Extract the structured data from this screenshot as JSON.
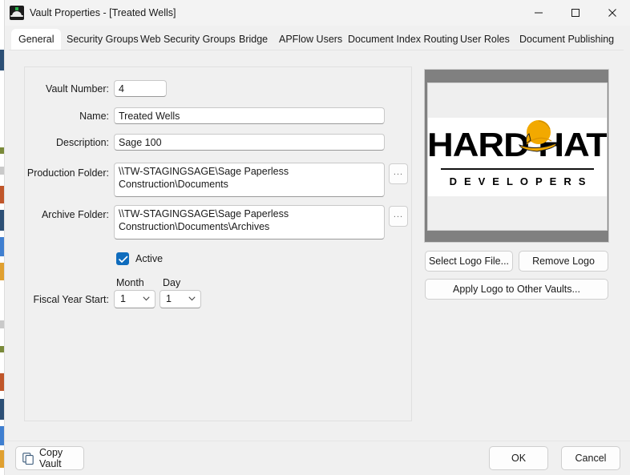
{
  "window": {
    "title": "Vault Properties - [Treated Wells]",
    "app_icon": "hard-hat-icon",
    "controls": {
      "minimize": "minimize-icon",
      "maximize": "maximize-icon",
      "close": "close-icon"
    }
  },
  "tabs": [
    {
      "label": "General",
      "active": true
    },
    {
      "label": "Security Groups",
      "active": false
    },
    {
      "label": "Web Security Groups",
      "active": false
    },
    {
      "label": "Bridge",
      "active": false
    },
    {
      "label": "APFlow Users",
      "active": false
    },
    {
      "label": "Document Index Routing",
      "active": false
    },
    {
      "label": "User Roles",
      "active": false
    },
    {
      "label": "Document Publishing",
      "active": false
    }
  ],
  "form": {
    "vault_number": {
      "label": "Vault Number:",
      "value": "4"
    },
    "name": {
      "label": "Name:",
      "value": "Treated Wells"
    },
    "description": {
      "label": "Description:",
      "value": "Sage 100"
    },
    "production_folder": {
      "label": "Production Folder:",
      "value": "\\\\TW-STAGINGSAGE\\Sage Paperless Construction\\Documents",
      "browse_label": "..."
    },
    "archive_folder": {
      "label": "Archive Folder:",
      "value": "\\\\TW-STAGINGSAGE\\Sage Paperless Construction\\Documents\\Archives",
      "browse_label": "..."
    },
    "active": {
      "label": "Active",
      "checked": true
    },
    "fiscal_year_start": {
      "label": "Fiscal Year Start:",
      "month_label": "Month",
      "month_value": "1",
      "day_label": "Day",
      "day_value": "1"
    }
  },
  "logo": {
    "word_top": "HARD HAT",
    "word_left": "HARD",
    "word_right": "HAT",
    "subtitle": "DEVELOPERS",
    "select_button": "Select Logo File...",
    "remove_button": "Remove Logo",
    "apply_button": "Apply Logo to Other Vaults..."
  },
  "footer": {
    "copy_vault": "Copy Vault",
    "copy_vault_icon": "copy-icon",
    "ok": "OK",
    "cancel": "Cancel"
  },
  "colors": {
    "accent": "#0f6cbd",
    "hardhat_yellow": "#f2a900",
    "window_bg": "#f0f0f0",
    "logo_frame": "#808080"
  }
}
